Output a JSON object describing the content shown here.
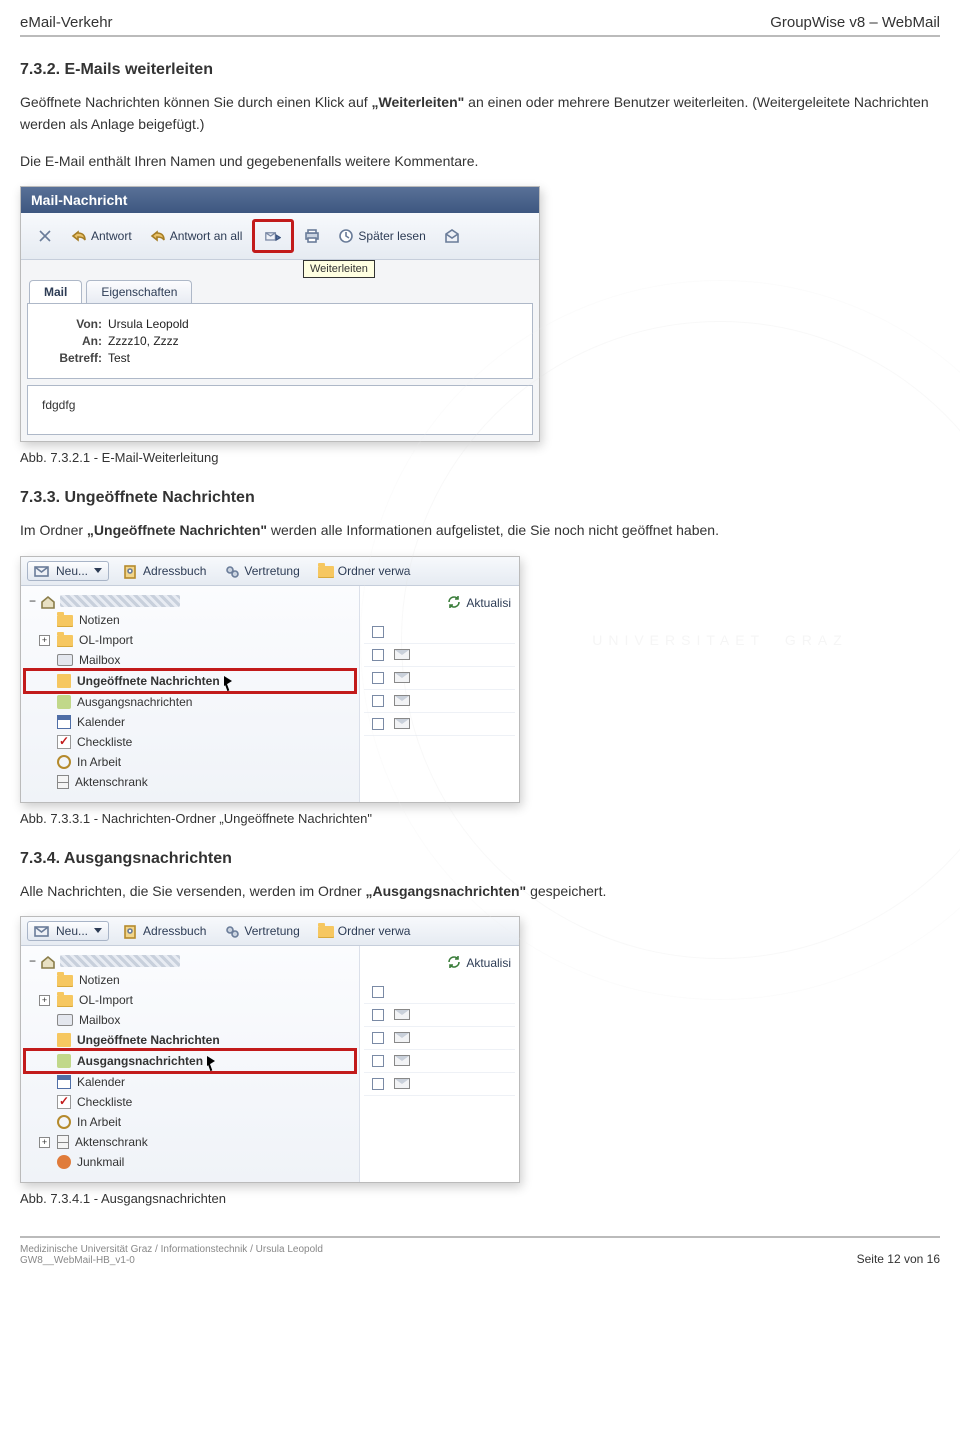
{
  "page_header": {
    "left": "eMail-Verkehr",
    "right": "GroupWise v8 – WebMail"
  },
  "sec_732": {
    "heading": "7.3.2. E-Mails weiterleiten",
    "p1_a": "Geöffnete Nachrichten können Sie durch einen Klick auf ",
    "p1_q": "„Weiterleiten\"",
    "p1_b": " an einen oder mehrere Benutzer weiterleiten. (Weitergeleitete Nachrichten werden als Anlage beigefügt.)",
    "p2": "Die E-Mail enthält Ihren Namen und gegebenenfalls weitere Kommentare."
  },
  "fig1": {
    "title": "Mail-Nachricht",
    "btn_antwort": "Antwort",
    "btn_antwort_alle": "Antwort an all",
    "btn_spaeter": "Später lesen",
    "tooltip": "Weiterleiten",
    "tab_mail": "Mail",
    "tab_eigenschaften": "Eigenschaften",
    "lbl_von": "Von:",
    "val_von": "Ursula Leopold",
    "lbl_an": "An:",
    "val_an": "Zzzz10, Zzzz",
    "lbl_betreff": "Betreff:",
    "val_betreff": "Test",
    "body": "fdgdfg",
    "caption": "Abb. 7.3.2.1  - E-Mail-Weiterleitung"
  },
  "sec_733": {
    "heading": "7.3.3. Ungeöffnete Nachrichten",
    "p_a": "Im Ordner ",
    "p_q": "„Ungeöffnete Nachrichten\"",
    "p_b": " werden alle Informationen aufgelistet, die Sie noch nicht geöffnet haben."
  },
  "folders_common": {
    "btn_neu": "Neu...",
    "btn_adressbuch": "Adressbuch",
    "btn_vertretung": "Vertretung",
    "btn_ordner": "Ordner verwa",
    "btn_aktualis": "Aktualisi"
  },
  "fig2": {
    "tree": {
      "notizen": "Notizen",
      "olimport": "OL-Import",
      "mailbox": "Mailbox",
      "ungelesen": "Ungeöffnete Nachrichten",
      "ausgang": "Ausgangsnachrichten",
      "kalender": "Kalender",
      "checkliste": "Checkliste",
      "inarbeit": "In Arbeit",
      "aktenschrank": "Aktenschrank"
    },
    "caption": "Abb. 7.3.3.1  - Nachrichten-Ordner „Ungeöffnete Nachrichten\""
  },
  "sec_734": {
    "heading": "7.3.4. Ausgangsnachrichten",
    "p_a": "Alle Nachrichten, die Sie versenden, werden im Ordner ",
    "p_q": "„Ausgangsnachrichten\"",
    "p_b": " gespeichert."
  },
  "fig3": {
    "tree": {
      "notizen": "Notizen",
      "olimport": "OL-Import",
      "mailbox": "Mailbox",
      "ungelesen": "Ungeöffnete Nachrichten",
      "ausgang": "Ausgangsnachrichten",
      "kalender": "Kalender",
      "checkliste": "Checkliste",
      "inarbeit": "In Arbeit",
      "aktenschrank": "Aktenschrank",
      "junk": "Junkmail"
    },
    "caption": "Abb. 7.3.4.1 - Ausgangsnachrichten"
  },
  "footer": {
    "line1": "Medizinische Universität Graz / Informationstechnik / Ursula Leopold",
    "line2": "GW8__WebMail-HB_v1-0",
    "pager": "Seite 12 von 16"
  }
}
